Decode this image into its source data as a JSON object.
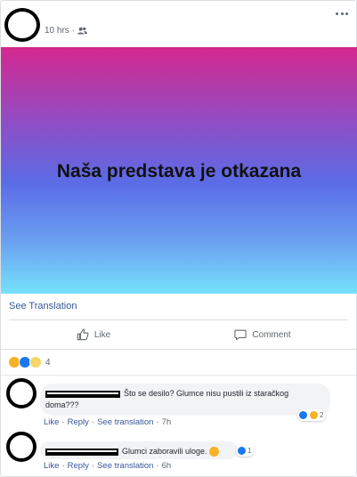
{
  "post": {
    "time": "10 hrs",
    "separator": "·",
    "audience_icon": "friends-icon",
    "menu_icon": "more-options-icon",
    "banner_text": "Naša predstava je otkazana",
    "see_translation": "See Translation",
    "colors": {
      "banner_top": "#d5288f",
      "banner_mid": "#5b6ce6",
      "banner_bottom": "#76e1fb",
      "link": "#385898"
    }
  },
  "actions": {
    "like_label": "Like",
    "comment_label": "Comment"
  },
  "reactions": {
    "types": [
      "wow",
      "like",
      "sad"
    ],
    "count": "4"
  },
  "comments": [
    {
      "text": "Što se desilo? Glumce nisu pustili iz staračkog doma???",
      "like": "Like",
      "reply": "Reply",
      "see_translation": "See translation",
      "time": "7h",
      "reaction_types": [
        "like",
        "haha"
      ],
      "reaction_count": "2"
    },
    {
      "text": "Glumci zaboravili uloge.",
      "emoji": "laughing-emoji",
      "like": "Like",
      "reply": "Reply",
      "see_translation": "See translation",
      "time": "6h",
      "reaction_types": [
        "like"
      ],
      "reaction_count": "1"
    }
  ]
}
